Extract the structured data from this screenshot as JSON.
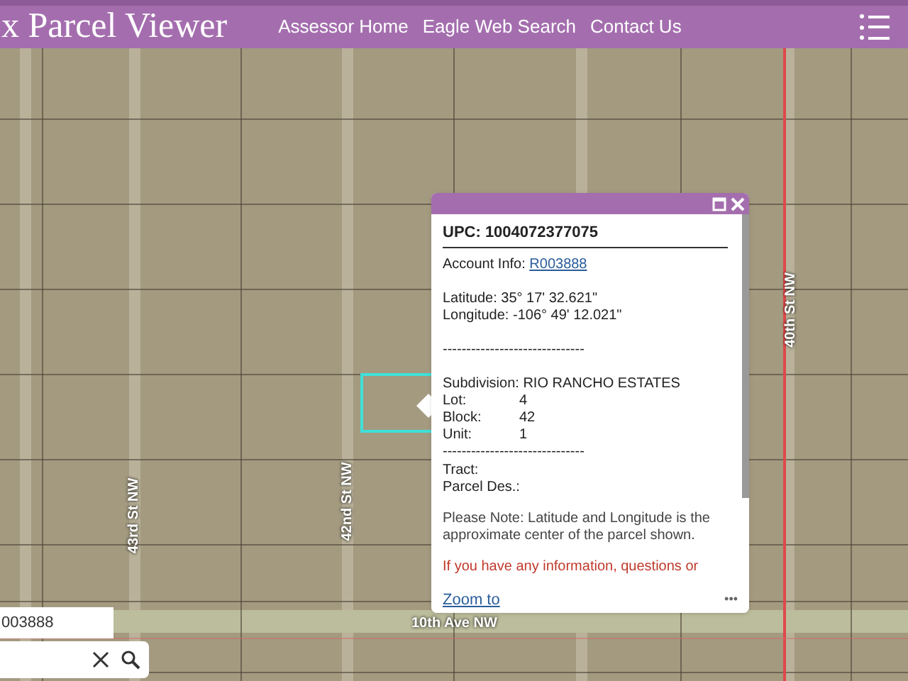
{
  "header": {
    "title": "x Parcel Viewer",
    "nav": [
      {
        "label": "Assessor Home"
      },
      {
        "label": "Eagle Web Search"
      },
      {
        "label": "Contact Us"
      }
    ]
  },
  "map": {
    "street_labels": [
      {
        "text": "43rd St NW",
        "kind": "vertical"
      },
      {
        "text": "42nd St NW",
        "kind": "vertical"
      },
      {
        "text": "40th St NW",
        "kind": "vertical"
      },
      {
        "text": "10th Ave NW",
        "kind": "horizontal"
      }
    ]
  },
  "popup": {
    "upc": "UPC: 1004072377075",
    "account_label": "Account Info: ",
    "account_link": "R003888",
    "latitude": "Latitude: 35° 17' 32.621\"",
    "longitude": "Longitude: -106° 49' 12.021\"",
    "separator": "------------------------------",
    "subdivision": "Subdivision: RIO RANCHO ESTATES",
    "fields": [
      {
        "label": "Lot:",
        "value": "4"
      },
      {
        "label": "Block:",
        "value": "42"
      },
      {
        "label": "Unit:",
        "value": "1"
      }
    ],
    "separator2": "------------------------------",
    "tract": "Tract:",
    "parcel_des": "Parcel Des.:",
    "note": "Please Note: Latitude and Longitude is the approximate center of the parcel shown.",
    "warning": "If you have any information, questions or",
    "zoom_link": "Zoom to",
    "more": "•••"
  },
  "search": {
    "suggestion": "003888"
  }
}
